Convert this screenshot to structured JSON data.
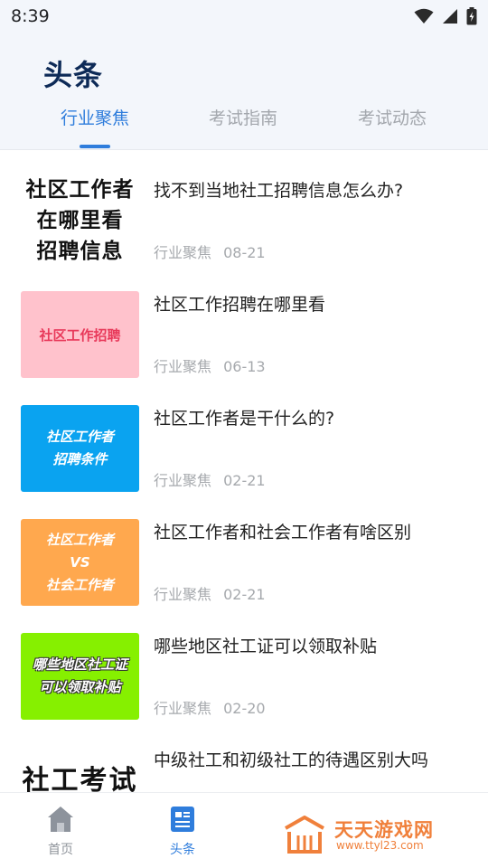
{
  "status_bar": {
    "time": "8:39",
    "icons": [
      "wifi-icon",
      "signal-icon",
      "battery-icon"
    ]
  },
  "header": {
    "title": "头条"
  },
  "tabs": [
    {
      "label": "行业聚焦",
      "active": true
    },
    {
      "label": "考试指南",
      "active": false
    },
    {
      "label": "考试动态",
      "active": false
    }
  ],
  "articles": [
    {
      "thumb_lines": [
        "社区工作者",
        "在哪里看",
        "招聘信息"
      ],
      "thumb_bg": "#ffffff",
      "title": "找不到当地社工招聘信息怎么办?",
      "category": "行业聚焦",
      "date": "08-21"
    },
    {
      "thumb_lines": [
        "社区工作招聘"
      ],
      "thumb_bg": "#ffc2cc",
      "title": "社区工作招聘在哪里看",
      "category": "行业聚焦",
      "date": "06-13"
    },
    {
      "thumb_lines": [
        "社区工作者",
        "招聘条件"
      ],
      "thumb_bg": "#0aa3f0",
      "title": "社区工作者是干什么的?",
      "category": "行业聚焦",
      "date": "02-21"
    },
    {
      "thumb_lines": [
        "社区工作者",
        "VS",
        "社会工作者"
      ],
      "thumb_bg": "#ffa84e",
      "title": "社区工作者和社会工作者有啥区别",
      "category": "行业聚焦",
      "date": "02-21"
    },
    {
      "thumb_lines": [
        "哪些地区社工证",
        "可以领取补贴"
      ],
      "thumb_bg": "#86f000",
      "title": "哪些地区社工证可以领取补贴",
      "category": "行业聚焦",
      "date": "02-20"
    },
    {
      "thumb_lines": [
        "社工考试"
      ],
      "thumb_bg": "#ffffff",
      "title": "中级社工和初级社工的待遇区别大吗",
      "category": "",
      "date": ""
    }
  ],
  "bottom_nav": [
    {
      "label": "首页",
      "icon": "home-icon",
      "active": false
    },
    {
      "label": "头条",
      "icon": "news-icon",
      "active": true
    }
  ],
  "watermark": {
    "name": "天天游戏网",
    "url": "www.ttyl23.com"
  },
  "colors": {
    "accent": "#2f7ddc",
    "title": "#0d2a57",
    "watermark": "#f0803b"
  }
}
